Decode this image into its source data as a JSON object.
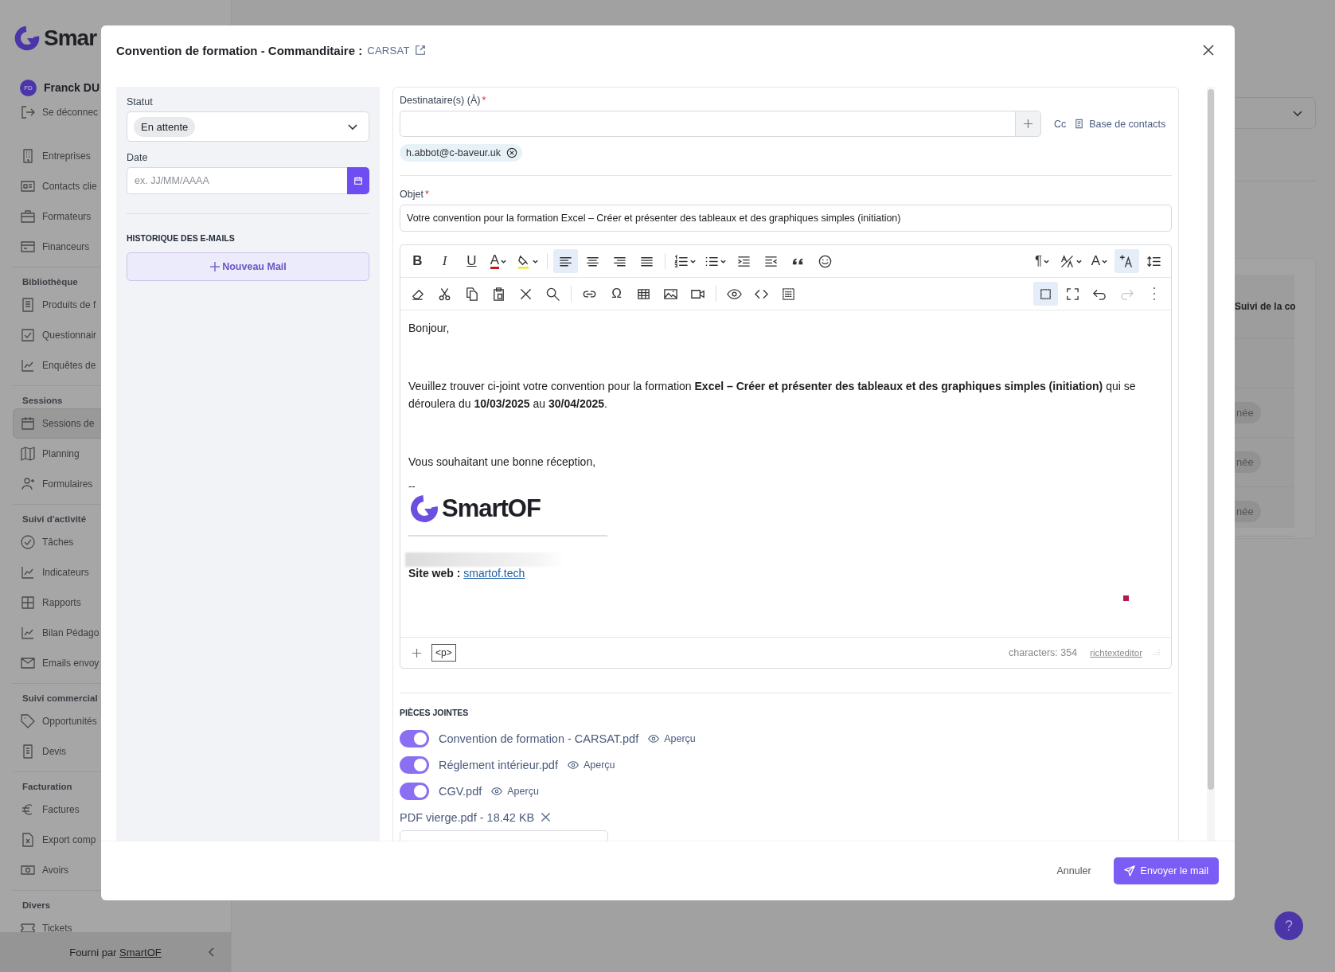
{
  "sidebar": {
    "logo": "Smar",
    "user": {
      "initials": "FD",
      "name": "Franck DU"
    },
    "logout": "Se déconnec",
    "sections": [
      {
        "items": [
          {
            "label": "Entreprises",
            "selected": false
          },
          {
            "label": "Contacts clie",
            "selected": false
          },
          {
            "label": "Formateurs",
            "selected": false
          },
          {
            "label": "Financeurs",
            "selected": false
          }
        ]
      },
      {
        "title": "Bibliothèque",
        "items": [
          {
            "label": "Produits de f",
            "selected": false
          },
          {
            "label": "Questionnair",
            "selected": false
          },
          {
            "label": "Enquêtes de",
            "selected": false
          }
        ]
      },
      {
        "title": "Sessions",
        "items": [
          {
            "label": "Sessions de",
            "selected": true
          },
          {
            "label": "Planning",
            "selected": false
          },
          {
            "label": "Formulaires",
            "selected": false
          }
        ]
      },
      {
        "title": "Suivi d'activité",
        "items": [
          {
            "label": "Tâches",
            "selected": false
          },
          {
            "label": "Indicateurs",
            "selected": false
          },
          {
            "label": "Rapports",
            "selected": false
          },
          {
            "label": "Bilan Pédago",
            "selected": false
          },
          {
            "label": "Emails envoy",
            "selected": false
          }
        ]
      },
      {
        "title": "Suivi commercial",
        "items": [
          {
            "label": "Opportunités",
            "selected": false
          },
          {
            "label": "Devis",
            "selected": false
          }
        ]
      },
      {
        "title": "Facturation",
        "items": [
          {
            "label": "Factures",
            "selected": false
          },
          {
            "label": "Export comp",
            "selected": false
          },
          {
            "label": "Avoirs",
            "selected": false
          }
        ]
      },
      {
        "title": "Divers",
        "items": [
          {
            "label": "Tickets",
            "selected": false
          }
        ]
      }
    ],
    "footer": {
      "text": "Fourni par",
      "link": "SmartOF"
    }
  },
  "background": {
    "column_header": "Suivi de la co",
    "chips": [
      "née",
      "née",
      "née"
    ],
    "help": "?"
  },
  "modal": {
    "title": "Convention de formation - Commanditaire :",
    "client_link": "CARSAT",
    "status": {
      "label": "Statut",
      "value": "En attente"
    },
    "date": {
      "label": "Date",
      "placeholder": "ex. JJ/MM/AAAA"
    },
    "history_title": "HISTORIQUE DES E-MAILS",
    "new_mail": "Nouveau Mail",
    "recipients": {
      "label": "Destinataire(s) (À)",
      "required_mark": "*",
      "cc": "Cc",
      "contacts": "Base de contacts",
      "chips": [
        "h.abbot@c-baveur.uk"
      ]
    },
    "subject": {
      "label": "Objet",
      "required_mark": "*",
      "value": "Votre convention pour la formation Excel – Créer et présenter des tableaux et des graphiques simples (initiation)"
    },
    "toolbar": [
      {
        "tools": [
          {
            "kind": "bold",
            "label": "B",
            "active": false,
            "disabled": false
          },
          {
            "kind": "italic",
            "label": "I",
            "active": false,
            "disabled": false
          },
          {
            "kind": "underline",
            "label": "U",
            "active": false,
            "disabled": false
          },
          {
            "kind": "font-color",
            "label": "A",
            "active": false,
            "disabled": false
          },
          {
            "kind": "highlight",
            "active": false,
            "disabled": false
          },
          {
            "kind": "separator"
          },
          {
            "kind": "align-left",
            "active": true,
            "disabled": false
          },
          {
            "kind": "align-center",
            "active": false,
            "disabled": false
          },
          {
            "kind": "align-right",
            "active": false,
            "disabled": false
          },
          {
            "kind": "justify",
            "active": false,
            "disabled": false
          },
          {
            "kind": "separator"
          },
          {
            "kind": "ordered-list",
            "active": false,
            "disabled": false
          },
          {
            "kind": "bullet-list",
            "active": false,
            "disabled": false
          },
          {
            "kind": "indent",
            "active": false,
            "disabled": false
          },
          {
            "kind": "outdent",
            "active": false,
            "disabled": false
          },
          {
            "kind": "quote",
            "active": false,
            "disabled": false
          },
          {
            "kind": "emoji",
            "active": false,
            "disabled": false
          },
          {
            "kind": "spacer"
          },
          {
            "kind": "paragraph",
            "label": "¶",
            "active": false,
            "disabled": false
          },
          {
            "kind": "format",
            "active": false,
            "disabled": false
          },
          {
            "kind": "font-size",
            "label": "A",
            "active": false,
            "disabled": false
          },
          {
            "kind": "insert-text",
            "active": true,
            "disabled": false
          },
          {
            "kind": "line-height",
            "active": false,
            "disabled": false
          }
        ]
      },
      {
        "tools": [
          {
            "kind": "eraser",
            "active": false,
            "disabled": false
          },
          {
            "kind": "cut",
            "active": false,
            "disabled": false
          },
          {
            "kind": "copy",
            "active": false,
            "disabled": false
          },
          {
            "kind": "paste",
            "active": false,
            "disabled": false
          },
          {
            "kind": "clear",
            "active": false,
            "disabled": false
          },
          {
            "kind": "search",
            "active": false,
            "disabled": false
          },
          {
            "kind": "separator"
          },
          {
            "kind": "link",
            "active": false,
            "disabled": false
          },
          {
            "kind": "special-char",
            "label": "Ω",
            "active": false,
            "disabled": false
          },
          {
            "kind": "table",
            "active": false,
            "disabled": false
          },
          {
            "kind": "image",
            "active": false,
            "disabled": false
          },
          {
            "kind": "video",
            "active": false,
            "disabled": false
          },
          {
            "kind": "separator"
          },
          {
            "kind": "preview",
            "active": false,
            "disabled": false
          },
          {
            "kind": "code",
            "active": false,
            "disabled": false
          },
          {
            "kind": "select-all",
            "active": false,
            "disabled": false
          },
          {
            "kind": "spacer"
          },
          {
            "kind": "show-blocks",
            "active": true,
            "disabled": false
          },
          {
            "kind": "fullscreen",
            "active": false,
            "disabled": false
          },
          {
            "kind": "undo",
            "active": false,
            "disabled": false
          },
          {
            "kind": "redo",
            "active": false,
            "disabled": true
          },
          {
            "kind": "more",
            "active": false,
            "disabled": false
          }
        ]
      }
    ],
    "body": {
      "greeting": "Bonjour,",
      "paragraph": "Veuillez trouver ci-joint votre convention pour la formation **Excel – Créer et présenter des tableaux et des graphiques simples (initiation)** qui se déroulera du **10/03/2025** au **30/04/2025**.",
      "closing": "Vous souhaitant une bonne réception,",
      "separator": "--",
      "logo": "SmartOF",
      "website_label": "Site web :",
      "website_link": "smartof.tech"
    },
    "editor_footer": {
      "tag": "<p>",
      "characters": "characters: 354",
      "brand": "richtexteditor"
    },
    "attachments_title": "PIÈCES JOINTES",
    "attachments": [
      {
        "name": "Convention de formation - CARSAT.pdf",
        "on": true,
        "preview": "Aperçu"
      },
      {
        "name": "Réglement intérieur.pdf",
        "on": true,
        "preview": "Aperçu"
      },
      {
        "name": "CGV.pdf",
        "on": true,
        "preview": "Aperçu"
      }
    ],
    "uploaded": [
      "PDF vierge.pdf - 18.42 KB"
    ],
    "cancel": "Annuler",
    "send": "Envoyer le mail"
  }
}
